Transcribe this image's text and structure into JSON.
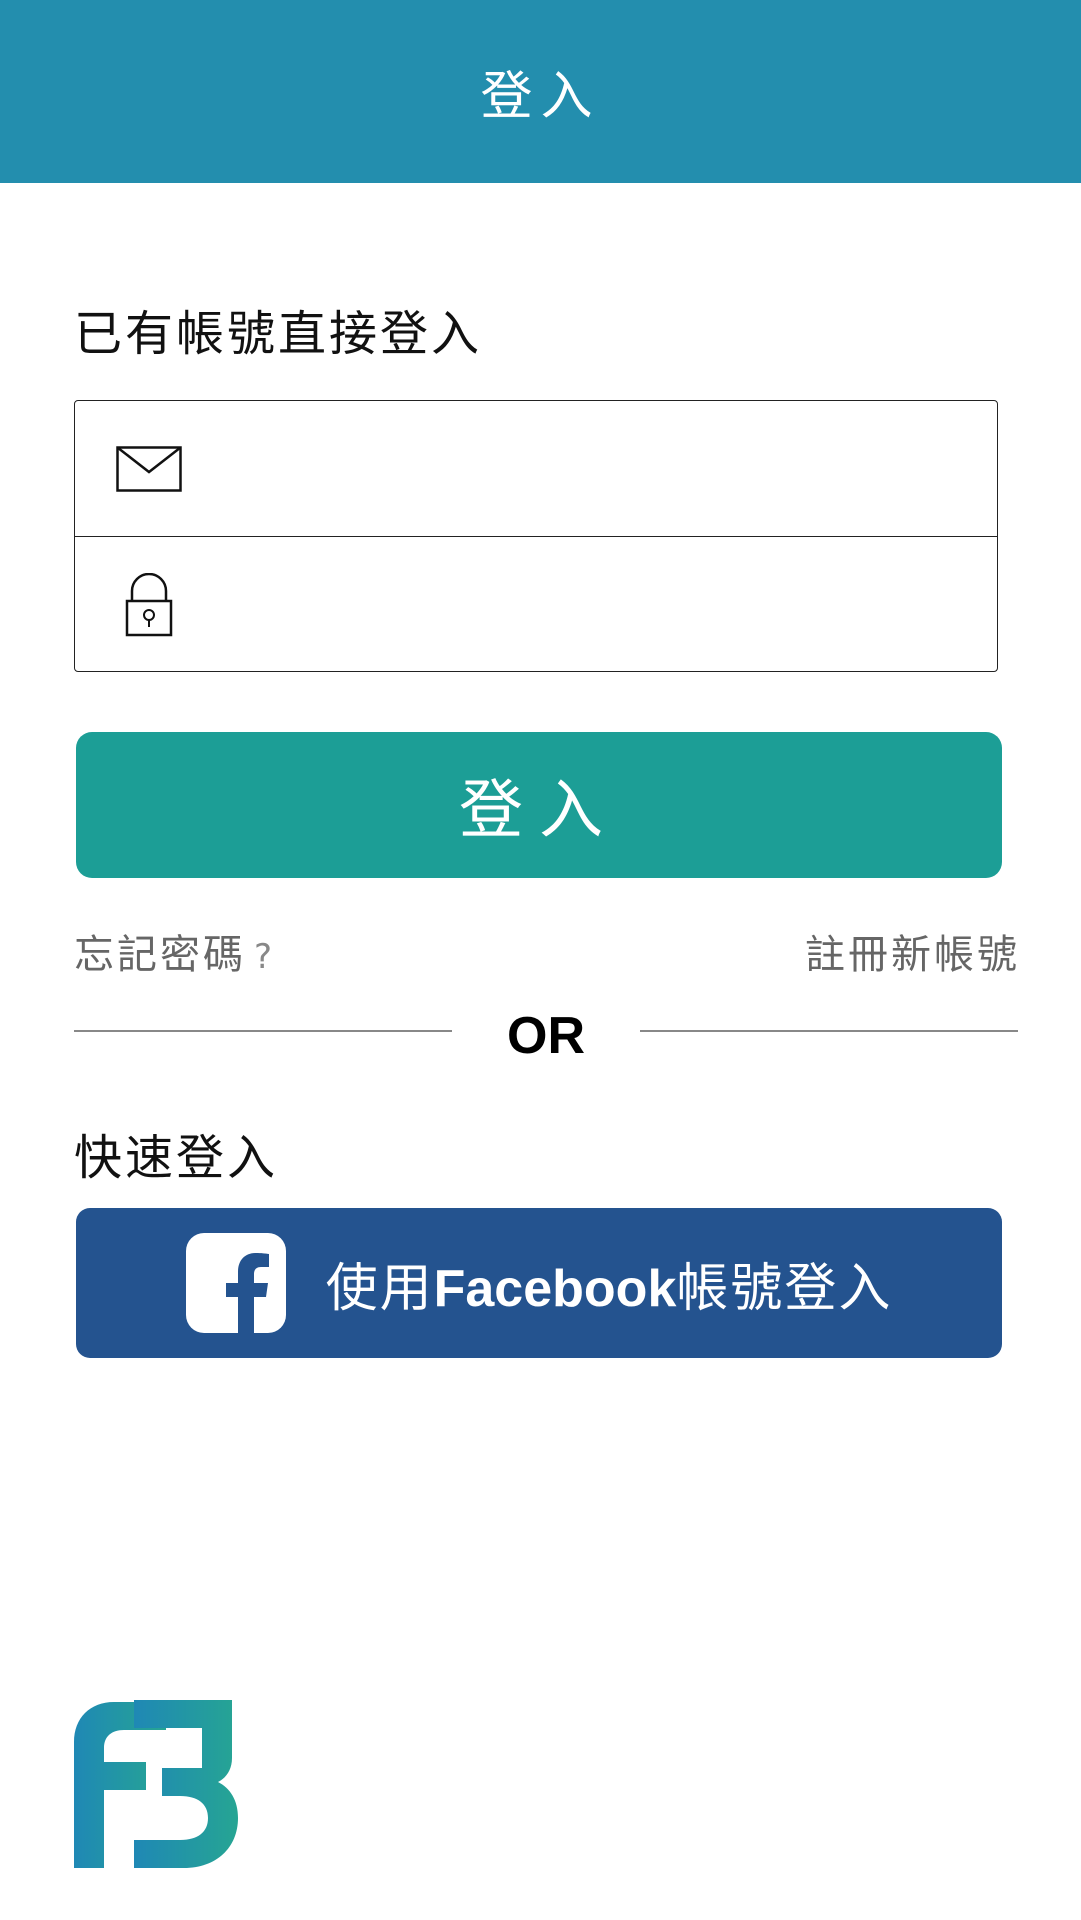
{
  "header": {
    "title": "登入"
  },
  "login_section": {
    "heading": "已有帳號直接登入"
  },
  "form": {
    "email_icon": "envelope-icon",
    "email_value": "",
    "email_placeholder": "",
    "password_icon": "lock-icon",
    "password_value": "",
    "password_placeholder": ""
  },
  "login_button": {
    "label": "登入"
  },
  "links": {
    "forgot_password": "忘記密碼",
    "forgot_q": "?",
    "register": "註冊新帳號"
  },
  "divider": {
    "text": "OR"
  },
  "quick_login": {
    "heading": "快速登入",
    "fb_prefix": "使用",
    "fb_word": "Facebook",
    "fb_suffix": "帳號登入",
    "fb_icon": "facebook-icon"
  },
  "brand": {
    "logo_icon": "fubon-logo-icon"
  },
  "colors": {
    "header_bg": "#238eae",
    "login_button": "#1c9e96",
    "facebook_button": "#24538f",
    "logo_blue": "#1f88b5",
    "logo_green": "#26a593"
  }
}
